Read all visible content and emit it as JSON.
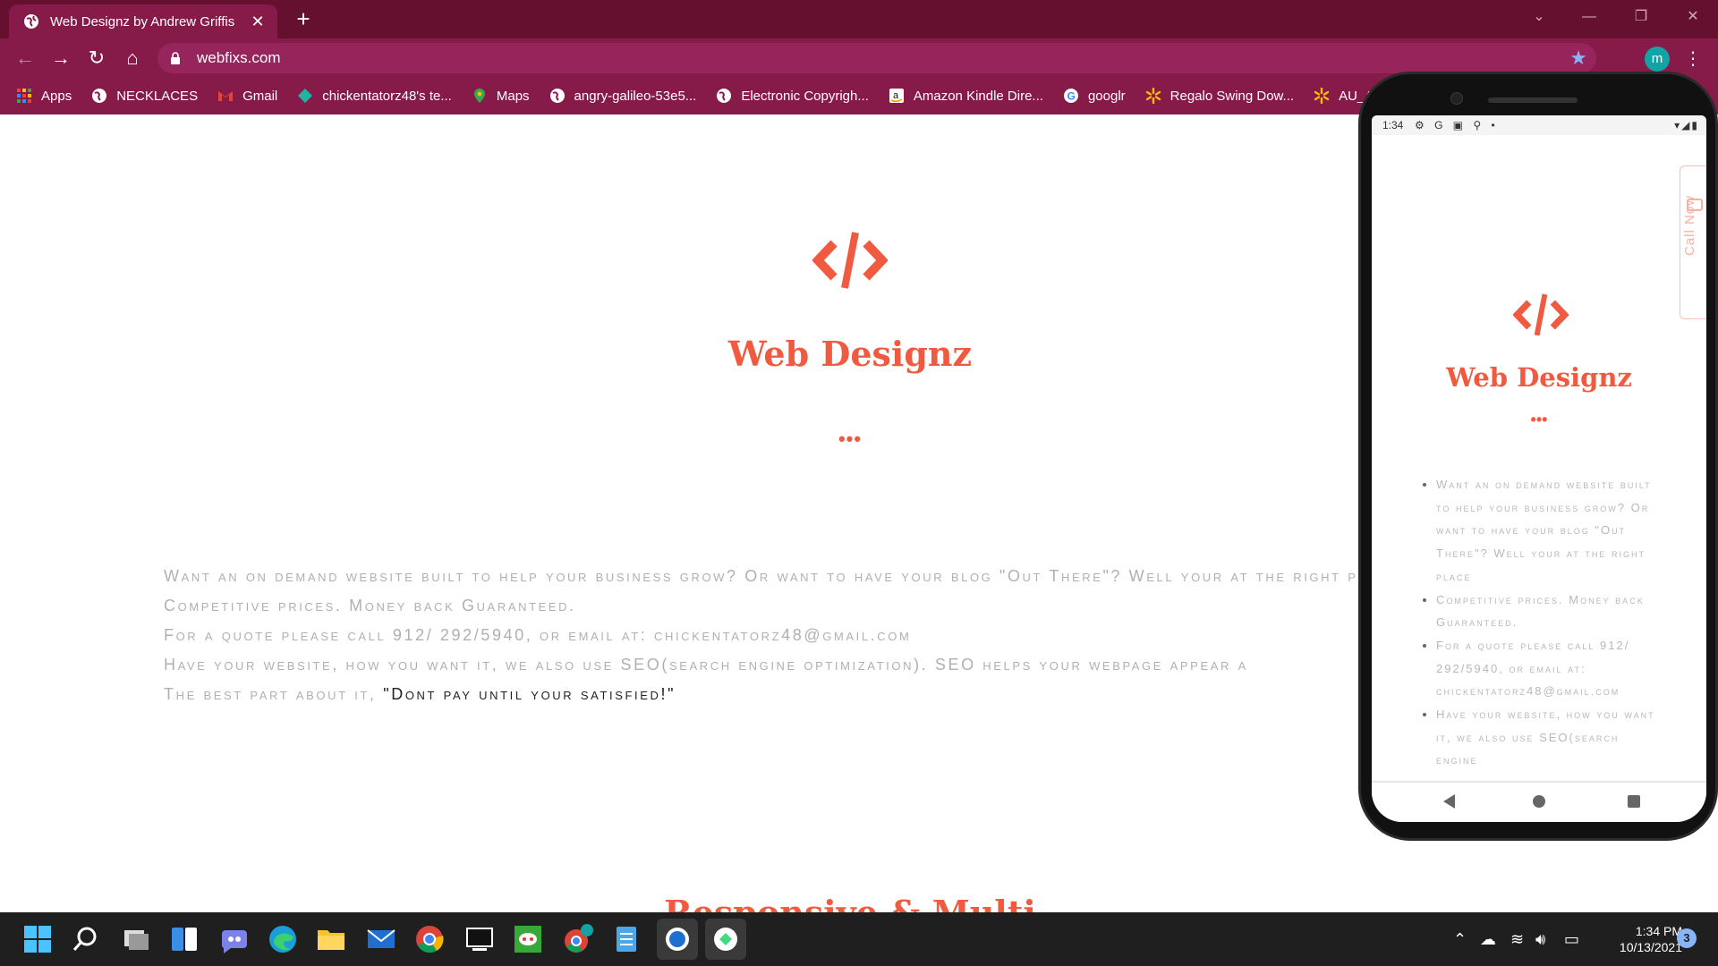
{
  "browser": {
    "tab_title": "Web Designz by Andrew Griffis",
    "url": "webfixs.com",
    "profile_initial": "m",
    "bookmarks": [
      {
        "label": "Apps",
        "icon": "apps-grid-icon"
      },
      {
        "label": "NECKLACES",
        "icon": "globe-icon"
      },
      {
        "label": "Gmail",
        "icon": "gmail-icon"
      },
      {
        "label": "chickentatorz48's te...",
        "icon": "diamond-icon"
      },
      {
        "label": "Maps",
        "icon": "maps-pin-icon"
      },
      {
        "label": "angry-galileo-53e5...",
        "icon": "globe-icon"
      },
      {
        "label": "Electronic Copyrigh...",
        "icon": "globe-icon"
      },
      {
        "label": "Amazon Kindle Dire...",
        "icon": "amazon-icon"
      },
      {
        "label": "googlr",
        "icon": "google-icon"
      },
      {
        "label": "Regalo Swing Dow...",
        "icon": "walmart-spark-icon"
      },
      {
        "label": "AU_Ar",
        "icon": "walmart-spark-icon"
      }
    ]
  },
  "site": {
    "title": "Web Designz",
    "dots": "•••",
    "features": [
      "Want an on demand website built to help your business grow? Or want to have your blog \"Out There\"? Well your at the right place",
      "Competitive prices. Money back Guaranteed.",
      "For a quote please call 912/ 292/5940, or email at: chickentatorz48@gmail.com",
      "Have your website, how you want it, we also use SEO(search engine optimization). SEO helps your webpage appear a"
    ],
    "last_feature_prefix": "The best part about it, ",
    "last_feature_quote": "\"Dont pay until your satisfied!\"",
    "next_section_heading": "Responsive & Multi"
  },
  "mobile": {
    "status_time": "1:34",
    "call_now": "Call Now",
    "title": "Web Designz",
    "dots": "•••",
    "features": [
      "Want an on demand website built to help your business grow? Or want to have your blog \"Out There\"? Well your at the right place",
      "Competitive prices. Money back Guaranteed.",
      "For a quote please call 912/ 292/5940, or email at: chickentatorz48@gmail.com",
      "Have your website, how you want it, we also use SEO(search engine"
    ]
  },
  "taskbar": {
    "time": "1:34 PM",
    "date": "10/13/2021",
    "notification_count": "3"
  },
  "colors": {
    "accent": "#f05a40",
    "chrome_dark": "#65102f",
    "chrome": "#861a49"
  }
}
